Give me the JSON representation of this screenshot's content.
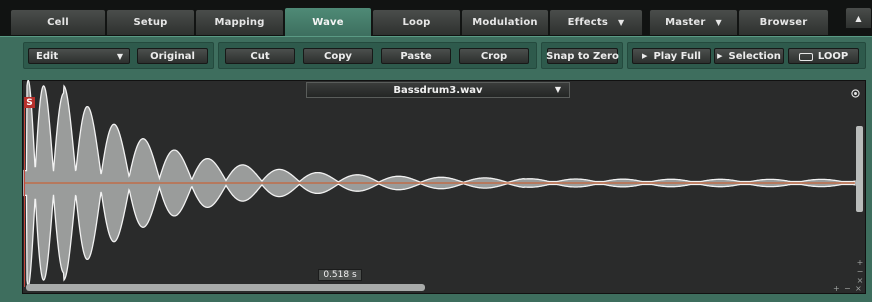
{
  "tabs": [
    {
      "label": "Cell",
      "active": false,
      "dropdown": false
    },
    {
      "label": "Setup",
      "active": false,
      "dropdown": false
    },
    {
      "label": "Mapping",
      "active": false,
      "dropdown": false
    },
    {
      "label": "Wave",
      "active": true,
      "dropdown": false
    },
    {
      "label": "Loop",
      "active": false,
      "dropdown": false
    },
    {
      "label": "Modulation",
      "active": false,
      "dropdown": false
    },
    {
      "label": "Effects",
      "active": false,
      "dropdown": true
    },
    {
      "label": "Master",
      "active": false,
      "dropdown": true
    },
    {
      "label": "Browser",
      "active": false,
      "dropdown": false
    }
  ],
  "collapse_icon": "triangle-up-icon",
  "toolbar": {
    "mode_select": "Edit",
    "original": "Original",
    "cut": "Cut",
    "copy": "Copy",
    "paste": "Paste",
    "crop": "Crop",
    "snap_to_zero": "Snap to Zero",
    "play_full": "Play Full",
    "selection": "Selection",
    "loop": "LOOP"
  },
  "wave": {
    "file": "Bassdrum3.wav",
    "start_marker": "S",
    "time_readout": "0.518 s",
    "zoom_in": "+",
    "zoom_out": "−",
    "zoom_reset": "×"
  },
  "colors": {
    "panel_green": "#3e6e5e",
    "active_tab": "#4f8a76",
    "wave_fill": "#9a9c9b",
    "center_line": "#c8643a",
    "marker_red": "#b7312c"
  }
}
